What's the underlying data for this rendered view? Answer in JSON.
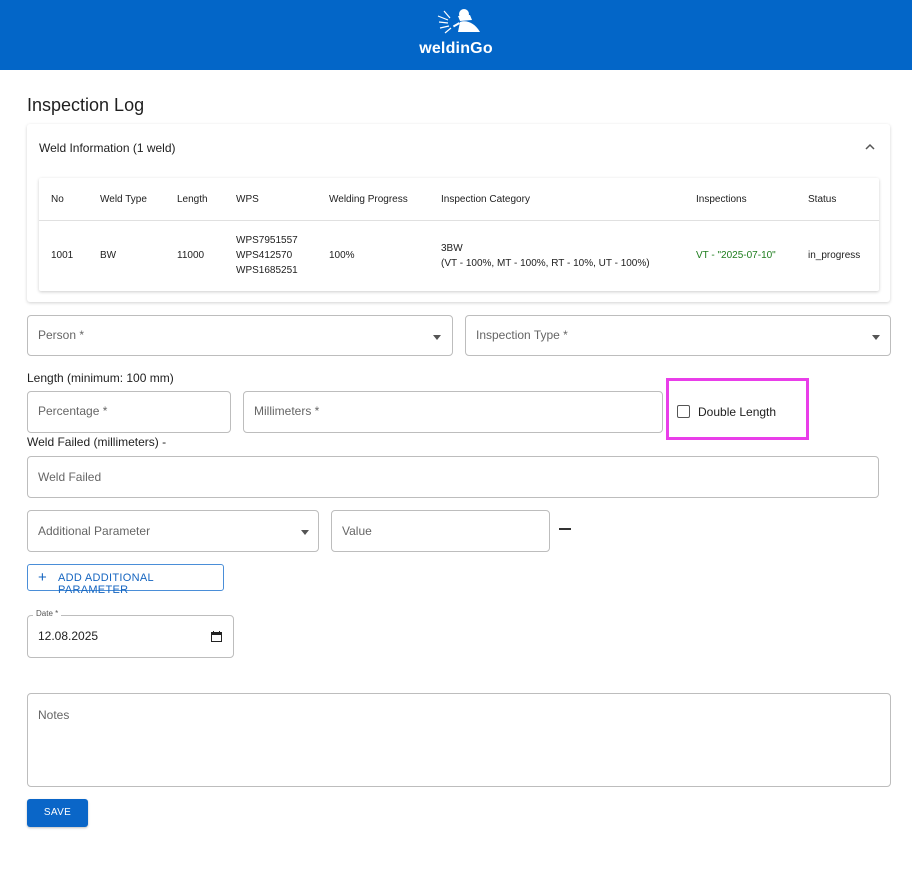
{
  "header": {
    "brand": "weldinGo",
    "logo_icon": "welder-icon",
    "background": "#0366c8"
  },
  "page": {
    "title": "Inspection Log"
  },
  "weld_info": {
    "title": "Weld Information (1 weld)",
    "toggle_icon": "chevron-up-icon",
    "columns": [
      "No",
      "Weld Type",
      "Length",
      "WPS",
      "Welding Progress",
      "Inspection Category",
      "Inspections",
      "Status"
    ],
    "rows": [
      {
        "no": "1001",
        "weld_type": "BW",
        "length": "11000",
        "wps": [
          "WPS7951557",
          "WPS412570",
          "WPS1685251"
        ],
        "progress": "100%",
        "category_code": "3BW",
        "category_detail": "(VT - 100%, MT - 100%, RT - 10%, UT - 100%)",
        "inspections": "VT - \"2025-07-10\"",
        "status": "in_progress"
      }
    ]
  },
  "form": {
    "person_label": "Person *",
    "inspection_type_label": "Inspection Type *",
    "length_heading": "Length (minimum: 100 mm)",
    "percentage_label": "Percentage *",
    "millimeters_label": "Millimeters *",
    "double_length_label": "Double Length",
    "double_length_checked": false,
    "weld_failed_heading": "Weld Failed (millimeters) -",
    "weld_failed_label": "Weld Failed",
    "additional_parameter_label": "Additional Parameter",
    "value_label": "Value",
    "remove_icon": "minus-icon",
    "add_parameter_label": "ADD ADDITIONAL PARAMETER",
    "add_icon": "plus-icon",
    "date_label": "Date *",
    "date_value": "12.08.2025",
    "date_icon": "calendar-icon",
    "notes_label": "Notes",
    "save_label": "SAVE"
  },
  "colors": {
    "primary": "#0a66c8",
    "highlight": "#e93ee9",
    "success": "#1e7d1e"
  }
}
